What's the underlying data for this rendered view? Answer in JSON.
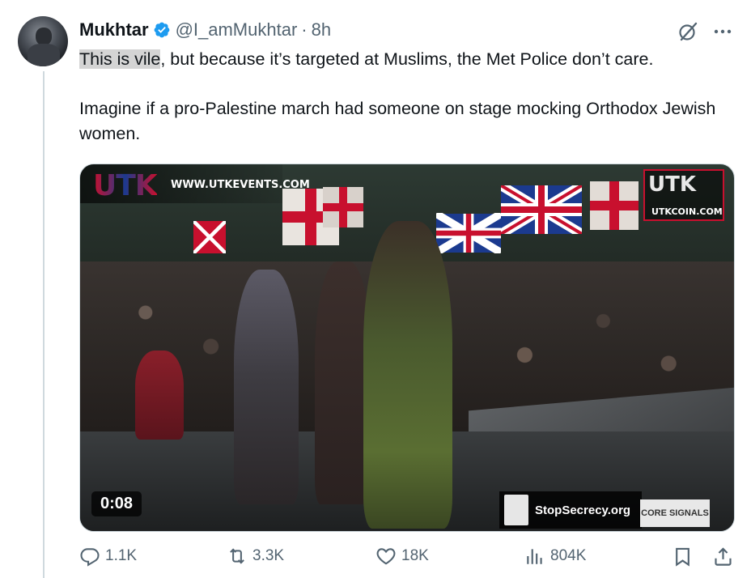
{
  "tweet": {
    "author_name": "Mukhtar",
    "handle": "@I_amMukhtar",
    "separator": "·",
    "time": "8h",
    "text_highlight": "This is vile",
    "text_rest": ", but because it’s targeted at Muslims, the Met Police don’t care.",
    "text_para2": "Imagine if a pro-Palestine march had someone on stage mocking Orthodox Jewish women."
  },
  "media": {
    "duration": "0:08",
    "watermark_logo": "UTK",
    "watermark_url": "WWW.UTKEVENTS.COM",
    "coin_logo": "UTK",
    "coin_url": "UTKCOIN.COM",
    "stopsecrecy": "StopSecrecy.org",
    "core_signals": "CORE SIGNALS"
  },
  "actions": {
    "replies": "1.1K",
    "reposts": "3.3K",
    "likes": "18K",
    "views": "804K"
  },
  "colors": {
    "verified": "#1d9bf0",
    "muted": "#536471",
    "highlight": "#d4d4d4"
  },
  "icons": [
    "verified-badge-icon",
    "grok-icon",
    "more-icon",
    "reply-icon",
    "repost-icon",
    "like-icon",
    "views-icon",
    "bookmark-icon",
    "share-icon"
  ]
}
